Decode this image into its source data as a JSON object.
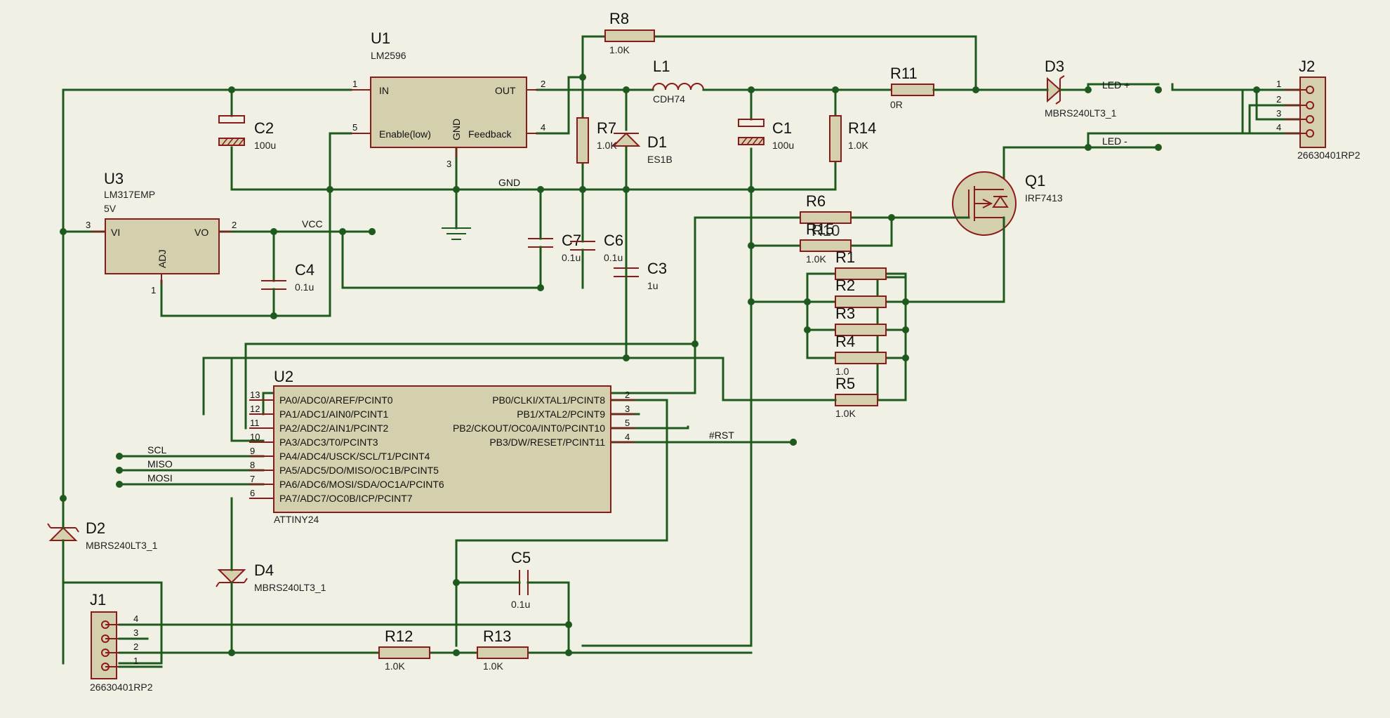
{
  "components": {
    "U1": {
      "ref": "U1",
      "value": "LM2596",
      "pins": {
        "in": "IN",
        "out": "OUT",
        "enable": "Enable(low)",
        "feedback": "Feedback",
        "gnd": "GND"
      },
      "pin_numbers": {
        "in": "1",
        "out": "2",
        "enable": "5",
        "feedback": "4",
        "gnd": "3"
      }
    },
    "U3": {
      "ref": "U3",
      "value": "LM317EMP",
      "value2": "5V",
      "pins": {
        "vi": "VI",
        "vo": "VO",
        "adj": "ADJ"
      },
      "pin_numbers": {
        "vi": "3",
        "vo": "2",
        "adj": "1"
      }
    },
    "U2": {
      "ref": "U2",
      "value": "ATTINY24",
      "left_pins": [
        {
          "num": "13",
          "name": "PA0/ADC0/AREF/PCINT0"
        },
        {
          "num": "12",
          "name": "PA1/ADC1/AIN0/PCINT1"
        },
        {
          "num": "11",
          "name": "PA2/ADC2/AIN1/PCINT2"
        },
        {
          "num": "10",
          "name": "PA3/ADC3/T0/PCINT3"
        },
        {
          "num": "9",
          "name": "PA4/ADC4/USCK/SCL/T1/PCINT4"
        },
        {
          "num": "8",
          "name": "PA5/ADC5/DO/MISO/OC1B/PCINT5"
        },
        {
          "num": "7",
          "name": "PA6/ADC6/MOSI/SDA/OC1A/PCINT6"
        },
        {
          "num": "6",
          "name": "PA7/ADC7/OC0B/ICP/PCINT7"
        }
      ],
      "right_pins": [
        {
          "num": "2",
          "name": "PB0/CLKI/XTAL1/PCINT8"
        },
        {
          "num": "3",
          "name": "PB1/XTAL2/PCINT9"
        },
        {
          "num": "5",
          "name": "PB2/CKOUT/OC0A/INT0/PCINT10"
        },
        {
          "num": "4",
          "name": "PB3/DW/RESET/PCINT11"
        }
      ]
    },
    "C1": {
      "ref": "C1",
      "value": "100u"
    },
    "C2": {
      "ref": "C2",
      "value": "100u"
    },
    "C3": {
      "ref": "C3",
      "value": "1u"
    },
    "C4": {
      "ref": "C4",
      "value": "0.1u"
    },
    "C5": {
      "ref": "C5",
      "value": "0.1u"
    },
    "C6": {
      "ref": "C6",
      "value": "0.1u"
    },
    "C7": {
      "ref": "C7",
      "value": "0.1u"
    },
    "R1": {
      "ref": "R1"
    },
    "R2": {
      "ref": "R2"
    },
    "R3": {
      "ref": "R3"
    },
    "R4": {
      "ref": "R4",
      "value": "1.0"
    },
    "R5": {
      "ref": "R5",
      "value": "1.0K"
    },
    "R6": {
      "ref": "R6"
    },
    "R7": {
      "ref": "R7",
      "value": "1.0K"
    },
    "R8": {
      "ref": "R8",
      "value": "1.0K"
    },
    "R10": {
      "ref": "R10"
    },
    "R11": {
      "ref": "R11",
      "value": "0R"
    },
    "R12": {
      "ref": "R12",
      "value": "1.0K"
    },
    "R13": {
      "ref": "R13",
      "value": "1.0K"
    },
    "R14": {
      "ref": "R14",
      "value": "1.0K"
    },
    "R15": {
      "ref": "R15",
      "value": "1.0K"
    },
    "L1": {
      "ref": "L1",
      "value": "CDH74"
    },
    "D1": {
      "ref": "D1",
      "value": "ES1B"
    },
    "D2": {
      "ref": "D2",
      "value": "MBRS240LT3_1"
    },
    "D3": {
      "ref": "D3",
      "value": "MBRS240LT3_1"
    },
    "D4": {
      "ref": "D4",
      "value": "MBRS240LT3_1"
    },
    "Q1": {
      "ref": "Q1",
      "value": "IRF7413"
    },
    "J1": {
      "ref": "J1",
      "value": "26630401RP2",
      "pins": [
        "4",
        "3",
        "2",
        "1"
      ]
    },
    "J2": {
      "ref": "J2",
      "value": "26630401RP2",
      "pins": [
        "1",
        "2",
        "3",
        "4"
      ]
    }
  },
  "nets": {
    "gnd": "GND",
    "vcc": "VCC",
    "led_plus": "LED +",
    "led_minus": "LED -",
    "scl": "SCL",
    "miso": "MISO",
    "mosi": "MOSI",
    "rst": "#RST"
  }
}
